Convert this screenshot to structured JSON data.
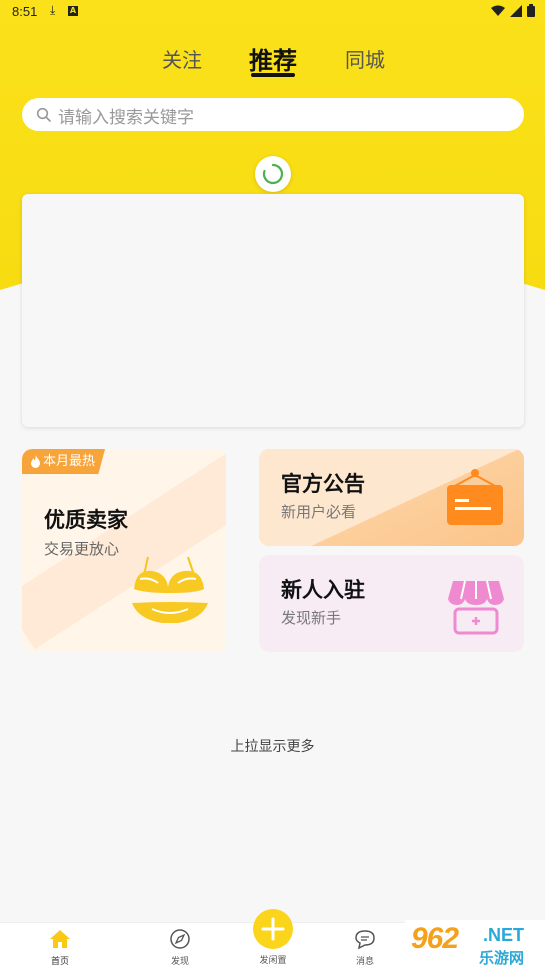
{
  "status": {
    "time": "8:51",
    "download_glyph": "⤓",
    "a_badge": "A"
  },
  "tabs": [
    {
      "label": "关注"
    },
    {
      "label": "推荐"
    },
    {
      "label": "同城"
    }
  ],
  "search": {
    "placeholder": "请输入搜索关键字"
  },
  "cards": {
    "seller": {
      "badge": "本月最热",
      "title": "优质卖家",
      "subtitle": "交易更放心"
    },
    "notice": {
      "title": "官方公告",
      "subtitle": "新用户必看"
    },
    "newbie": {
      "title": "新人入驻",
      "subtitle": "发现新手"
    }
  },
  "pull_more": "上拉显示更多",
  "nav": {
    "home": "首页",
    "discover": "发现",
    "post": "发闲置",
    "messages": "消息"
  },
  "watermark": {
    "number": "962",
    "net": ".NET",
    "cn": "乐游网"
  },
  "colors": {
    "brand_yellow": "#f7dc12",
    "accent_orange": "#f7a43b",
    "nav_post": "#fbd41c"
  }
}
